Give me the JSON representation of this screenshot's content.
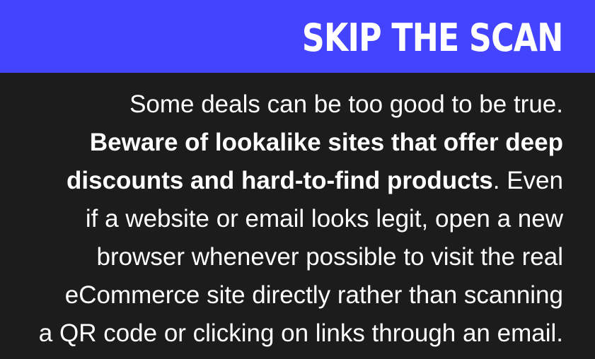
{
  "header": {
    "title": "SKIP THE SCAN"
  },
  "article": {
    "line1": "Some deals can be too good to be true.",
    "line2_bold": "Beware of lookalike sites that offer deep",
    "line3_bold": "discounts and hard-to-find products",
    "line3_rest": ". Even",
    "line4": "if a website or email looks legit, open a new",
    "line5": "browser whenever possible to visit the real",
    "line6": "eCommerce site directly rather than scanning",
    "line7": "a QR code or clicking on links through an email."
  },
  "colors": {
    "header_background": "#4444ff",
    "page_background": "#1c1c1c",
    "text": "#ffffff"
  }
}
